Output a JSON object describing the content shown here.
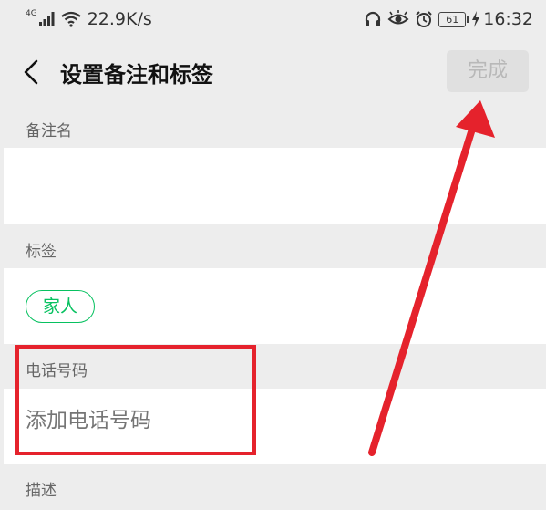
{
  "status_bar": {
    "network": "4G",
    "speed": "22.9K/s",
    "battery": "61",
    "time": "16:32"
  },
  "nav": {
    "title": "设置备注和标签",
    "done_label": "完成"
  },
  "remark": {
    "label": "备注名",
    "value": ""
  },
  "tags": {
    "label": "标签",
    "items": [
      "家人"
    ]
  },
  "phone": {
    "label": "电话号码",
    "placeholder": "添加电话号码"
  },
  "description": {
    "label": "描述"
  },
  "colors": {
    "accent_green": "#07c160",
    "annotation_red": "#e5222c",
    "background": "#ededed"
  },
  "icons": [
    "signal-icon",
    "wifi-icon",
    "headphones-icon",
    "eye-icon",
    "alarm-icon",
    "battery-icon",
    "charging-icon",
    "back-arrow-icon"
  ]
}
